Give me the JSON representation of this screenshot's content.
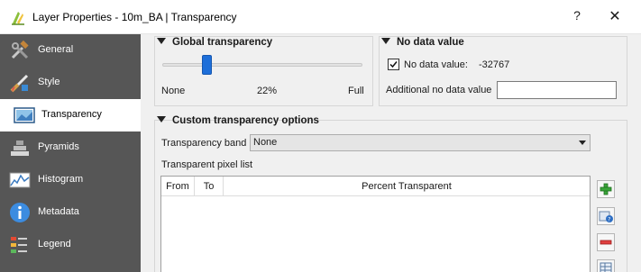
{
  "window": {
    "title": "Layer Properties - 10m_BA | Transparency",
    "help_label": "?",
    "close_label": "✕"
  },
  "sidebar": {
    "items": [
      {
        "label": "General",
        "icon": "wrench-hammer-icon"
      },
      {
        "label": "Style",
        "icon": "paintbrush-icon"
      },
      {
        "label": "Transparency",
        "icon": "transparency-icon",
        "active": true
      },
      {
        "label": "Pyramids",
        "icon": "pyramid-icon"
      },
      {
        "label": "Histogram",
        "icon": "histogram-icon"
      },
      {
        "label": "Metadata",
        "icon": "info-icon"
      },
      {
        "label": "Legend",
        "icon": "legend-icon"
      }
    ]
  },
  "global_transparency": {
    "title": "Global transparency",
    "min_label": "None",
    "value_label": "22%",
    "max_label": "Full",
    "value": 0.22
  },
  "no_data": {
    "title": "No data value",
    "checkbox_label": "No data value:",
    "checked": true,
    "nodata_value": "-32767",
    "additional_label": "Additional no data value",
    "additional_value": ""
  },
  "custom": {
    "title": "Custom transparency options",
    "band_label": "Transparency band",
    "band_value": "None",
    "list_label": "Transparent pixel list",
    "columns": [
      "From",
      "To",
      "Percent Transparent"
    ]
  },
  "colors": {
    "sidebar_bg": "#565656",
    "accent": "#1e6fd9"
  }
}
